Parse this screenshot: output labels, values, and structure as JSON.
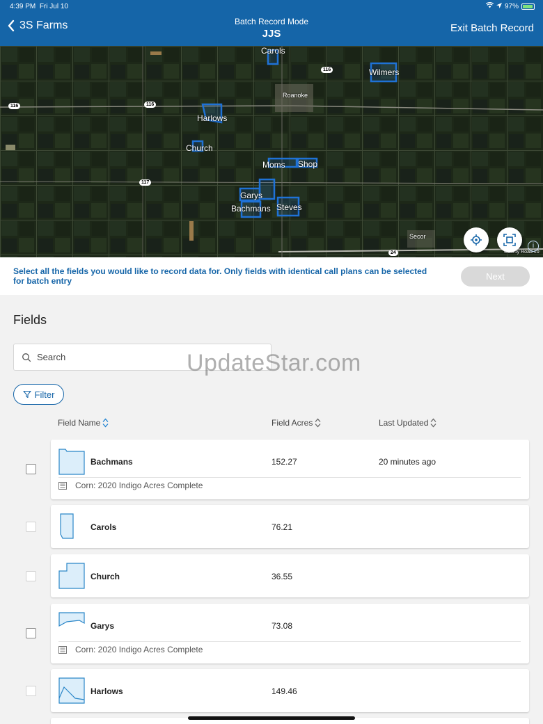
{
  "status": {
    "time": "4:39 PM",
    "date": "Fri Jul 10",
    "battery": "97%"
  },
  "header": {
    "back_label": "3S Farms",
    "subtitle": "Batch Record Mode",
    "title": "JJS",
    "exit_label": "Exit Batch Record"
  },
  "map": {
    "fields": [
      "Carols",
      "Wilmers",
      "Harlows",
      "Church",
      "Moms",
      "Shop",
      "Garys",
      "Bachmans",
      "Steves"
    ],
    "towns": [
      "Roanoke",
      "Secor"
    ],
    "roads": [
      "116",
      "116",
      "116",
      "117",
      "24"
    ],
    "road_label": "County Road 10",
    "boundary_color": "#1f72d6"
  },
  "instructions": {
    "text": "Select all the fields you would like to record data for. Only fields with identical call plans can be selected for batch entry",
    "next_label": "Next"
  },
  "fields_section": {
    "title": "Fields",
    "search_placeholder": "Search",
    "filter_label": "Filter",
    "columns": {
      "name": "Field Name",
      "acres": "Field Acres",
      "updated": "Last Updated"
    }
  },
  "rows": [
    {
      "name": "Bachmans",
      "acres": "152.27",
      "updated": "20 minutes ago",
      "plan": "Corn: 2020 Indigo Acres Complete",
      "selectable": true
    },
    {
      "name": "Carols",
      "acres": "76.21",
      "updated": "",
      "plan": "",
      "selectable": false
    },
    {
      "name": "Church",
      "acres": "36.55",
      "updated": "",
      "plan": "",
      "selectable": false
    },
    {
      "name": "Garys",
      "acres": "73.08",
      "updated": "",
      "plan": "Corn: 2020 Indigo Acres Complete",
      "selectable": true
    },
    {
      "name": "Harlows",
      "acres": "149.46",
      "updated": "",
      "plan": "",
      "selectable": false
    }
  ],
  "watermark": "UpdateStar.com",
  "colors": {
    "brand": "#1565a8",
    "next_disabled": "#d9d9d9"
  }
}
